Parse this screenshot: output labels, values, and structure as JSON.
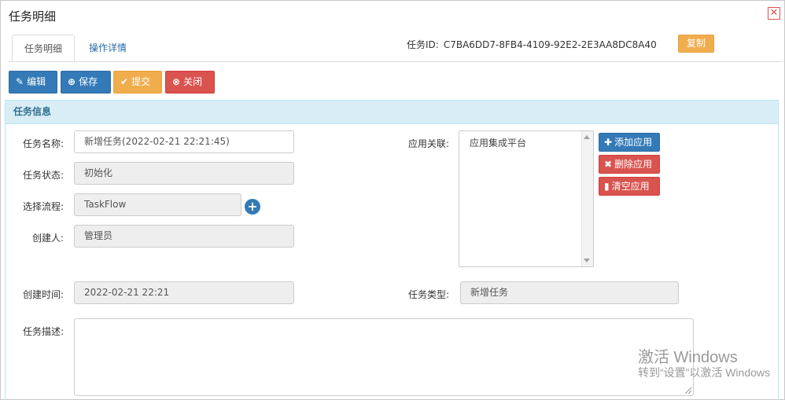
{
  "window": {
    "title": "任务明细",
    "close_icon": "close-icon"
  },
  "tabs": [
    {
      "label": "任务明细",
      "active": true
    },
    {
      "label": "操作详情",
      "active": false
    }
  ],
  "task_id": {
    "label": "任务ID:",
    "value": "C7BA6DD7-8FB4-4109-92E2-2E3AA8DC8A40",
    "copy_label": "复制"
  },
  "toolbar": {
    "edit_label": "编辑",
    "save_label": "保存",
    "submit_label": "提交",
    "close_label": "关闭"
  },
  "panel": {
    "title": "任务信息"
  },
  "form": {
    "name_label": "任务名称:",
    "name_value": "新增任务(2022-02-21 22:21:45)",
    "status_label": "任务状态:",
    "status_value": "初始化",
    "flow_label": "选择流程:",
    "flow_value": "TaskFlow",
    "creator_label": "创建人:",
    "creator_value": "管理员",
    "created_time_label": "创建时间:",
    "created_time_value": "2022-02-21 22:21",
    "app_label": "应用关联:",
    "app_options": [
      "应用集成平台"
    ],
    "type_label": "任务类型:",
    "type_value": "新增任务",
    "desc_label": "任务描述:",
    "desc_value": ""
  },
  "app_buttons": {
    "add_label": "添加应用",
    "delete_label": "删除应用",
    "clear_label": "清空应用"
  },
  "watermark": {
    "line1": "激活 Windows",
    "line2": "转到“设置”以激活 Windows"
  },
  "colors": {
    "primary": "#337ab7",
    "warning": "#f0ad4e",
    "danger": "#d9534f",
    "panel_head": "#d9edf7"
  }
}
